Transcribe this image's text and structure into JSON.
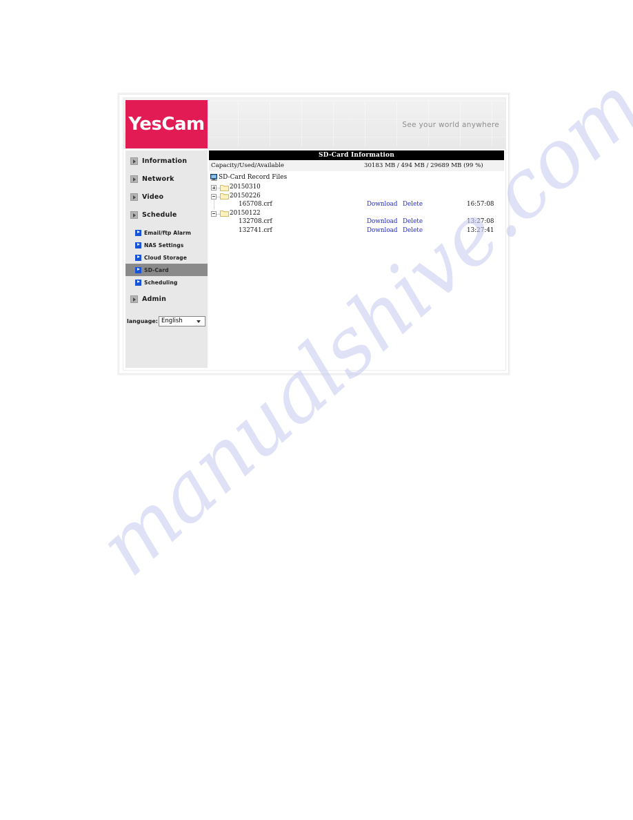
{
  "watermark": {
    "text": "manualshive.com"
  },
  "header": {
    "logo_text": "YesCam",
    "tagline": "See your world anywhere"
  },
  "sidebar": {
    "top_items": [
      {
        "label": "Information",
        "icon": "triangle-right-icon"
      },
      {
        "label": "Network",
        "icon": "triangle-right-icon"
      },
      {
        "label": "Video",
        "icon": "triangle-right-icon"
      },
      {
        "label": "Schedule",
        "icon": "triangle-right-icon"
      }
    ],
    "sub_items": [
      {
        "label": "Email/ftp Alarm",
        "active": false
      },
      {
        "label": "NAS Settings",
        "active": false
      },
      {
        "label": "Cloud Storage",
        "active": false
      },
      {
        "label": "SD-Card",
        "active": true
      },
      {
        "label": "Scheduling",
        "active": false
      }
    ],
    "admin_item": {
      "label": "Admin",
      "icon": "triangle-right-icon"
    },
    "language": {
      "label": "language:",
      "selected": "English",
      "options": [
        "English"
      ]
    }
  },
  "main": {
    "panel_title": "SD-Card Information",
    "capacity_row": {
      "label": "Capacity/Used/Available",
      "value": "30183 MB / 494 MB / 29689 MB (99 %)"
    },
    "tree_title": "SD-Card Record Files",
    "tree": [
      {
        "type": "folder",
        "name": "20150310",
        "expander": "plus",
        "files": []
      },
      {
        "type": "folder",
        "name": "20150226",
        "expander": "minus",
        "files": [
          {
            "name": "165708.crf",
            "download": "Download",
            "delete": "Delete",
            "time": "16:57:08"
          }
        ]
      },
      {
        "type": "folder",
        "name": "20150122",
        "expander": "minus",
        "files": [
          {
            "name": "132708.crf",
            "download": "Download",
            "delete": "Delete",
            "time": "13:27:08"
          },
          {
            "name": "132741.crf",
            "download": "Download",
            "delete": "Delete",
            "time": "13:27:41"
          }
        ]
      }
    ]
  },
  "colors": {
    "brand_pink": "#e31b54",
    "link_blue": "#2029c8",
    "sub_icon_blue": "#1753d6",
    "active_row": "#8a8a8a",
    "panel_title_bg": "#000000"
  }
}
